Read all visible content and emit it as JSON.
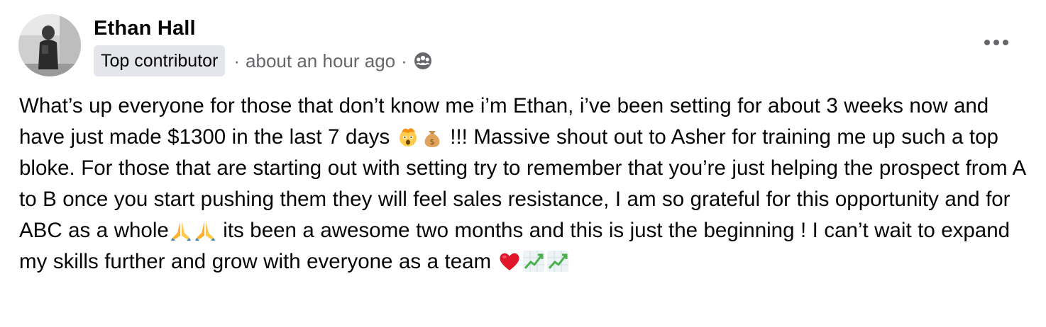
{
  "post": {
    "author": {
      "name": "Ethan Hall"
    },
    "badge": "Top contributor",
    "separator": "·",
    "time": "about an hour ago",
    "audience_icon": "group-audience-icon",
    "menu_icon": "more-options-icon",
    "body": {
      "segment_1": "What’s up everyone for those that don’t know me i’m Ethan, i’ve been setting for about 3 weeks now and have just made $1300 in the last 7 days",
      "segment_2": "!!! Massive shout out to Asher for training me up such a top bloke. For those that are starting out with setting try to remember that you’re just helping the prospect from A to B once you start pushing them they will feel sales resistance, I am so grateful for this opportunity and for ABC as a whole",
      "segment_3": "its been a awesome two months and this is just the beginning ! I can’t wait to expand my skills further and grow with everyone as a team",
      "emojis": [
        "exploding-head-emoji",
        "money-bag-emoji",
        "folded-hands-emoji",
        "folded-hands-emoji",
        "red-heart-emoji",
        "chart-increasing-emoji",
        "chart-increasing-emoji"
      ]
    }
  },
  "colors": {
    "text": "#050505",
    "secondary_text": "#65676b",
    "badge_bg": "#e4e6eb"
  }
}
